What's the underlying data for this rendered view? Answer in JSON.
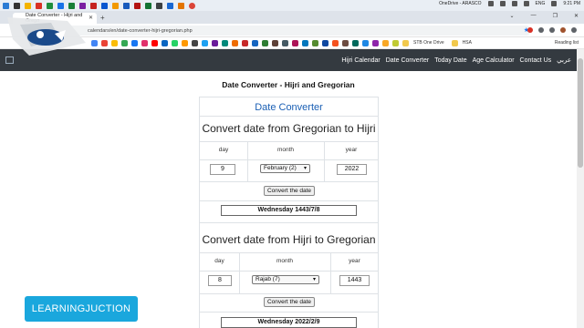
{
  "taskbar": {
    "status": "OneDrive - ARASCO",
    "language": "ENG",
    "time": "9:21 PM"
  },
  "browser": {
    "tab_title": "Date Converter - Hijri and Grego",
    "url": "calendars/en/date-converter-hijri-gregorian.php",
    "bookmarks": [
      "STB One Drive",
      "HSA"
    ],
    "reading_list": "Reading list"
  },
  "nav": {
    "items": [
      "Hijri Calendar",
      "Date Converter",
      "Today Date",
      "Age Calculator",
      "Contact Us",
      "عربي"
    ]
  },
  "page": {
    "title": "Date Converter - Hijri and Gregorian",
    "card_title": "Date Converter"
  },
  "g2h": {
    "title": "Convert date from Gregorian to Hijri",
    "headers": [
      "day",
      "month",
      "year"
    ],
    "day": "9",
    "month": "February (2)",
    "year": "2022",
    "button": "Convert the date",
    "result": "Wednesday 1443/7/8"
  },
  "h2g": {
    "title": "Convert date from Hijri to Gregorian",
    "headers": [
      "day",
      "month",
      "year"
    ],
    "day": "8",
    "month": "Rajab (7)",
    "year": "1443",
    "button": "Convert the date",
    "result": "Wednesday 2022/2/9"
  },
  "badge": "LEARNINGJUCTION"
}
